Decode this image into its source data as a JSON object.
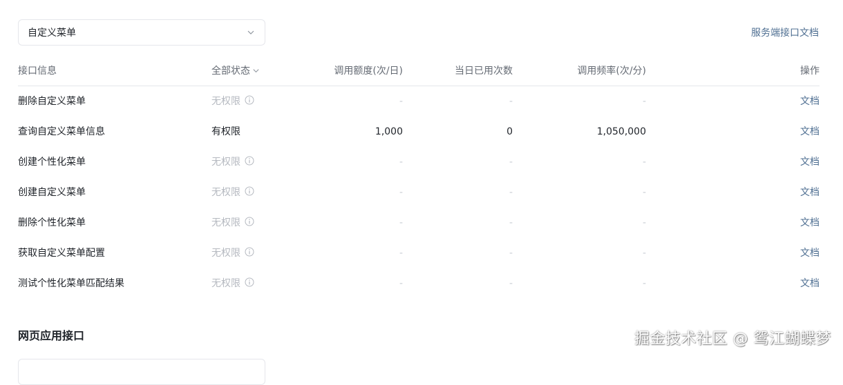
{
  "menu_select": {
    "value": "自定义菜单"
  },
  "server_doc_link": "服务端接口文档",
  "table": {
    "headers": {
      "name": "接口信息",
      "status": "全部状态",
      "quota": "调用额度(次/日)",
      "used": "当日已用次数",
      "rate": "调用频率(次/分)",
      "op": "操作"
    },
    "rows": [
      {
        "name": "删除自定义菜单",
        "status": "无权限",
        "has_permission": false,
        "quota": "-",
        "used": "-",
        "rate": "-",
        "op": "文档"
      },
      {
        "name": "查询自定义菜单信息",
        "status": "有权限",
        "has_permission": true,
        "quota": "1,000",
        "used": "0",
        "rate": "1,050,000",
        "op": "文档"
      },
      {
        "name": "创建个性化菜单",
        "status": "无权限",
        "has_permission": false,
        "quota": "-",
        "used": "-",
        "rate": "-",
        "op": "文档"
      },
      {
        "name": "创建自定义菜单",
        "status": "无权限",
        "has_permission": false,
        "quota": "-",
        "used": "-",
        "rate": "-",
        "op": "文档"
      },
      {
        "name": "删除个性化菜单",
        "status": "无权限",
        "has_permission": false,
        "quota": "-",
        "used": "-",
        "rate": "-",
        "op": "文档"
      },
      {
        "name": "获取自定义菜单配置",
        "status": "无权限",
        "has_permission": false,
        "quota": "-",
        "used": "-",
        "rate": "-",
        "op": "文档"
      },
      {
        "name": "测试个性化菜单匹配结果",
        "status": "无权限",
        "has_permission": false,
        "quota": "-",
        "used": "-",
        "rate": "-",
        "op": "文档"
      }
    ]
  },
  "next_section_title": "网页应用接口",
  "watermark": "掘金技术社区 @ 鸳江蝴蝶梦",
  "icons": {
    "select": "chevron-down-icon",
    "status_filter": "chevron-down-icon",
    "no_permission": "info-circle-icon"
  },
  "colors": {
    "link": "#4f6f92",
    "text": "#1f2329",
    "muted": "#646a73",
    "disabled": "#b5b9c0",
    "border": "#e5e6eb"
  }
}
